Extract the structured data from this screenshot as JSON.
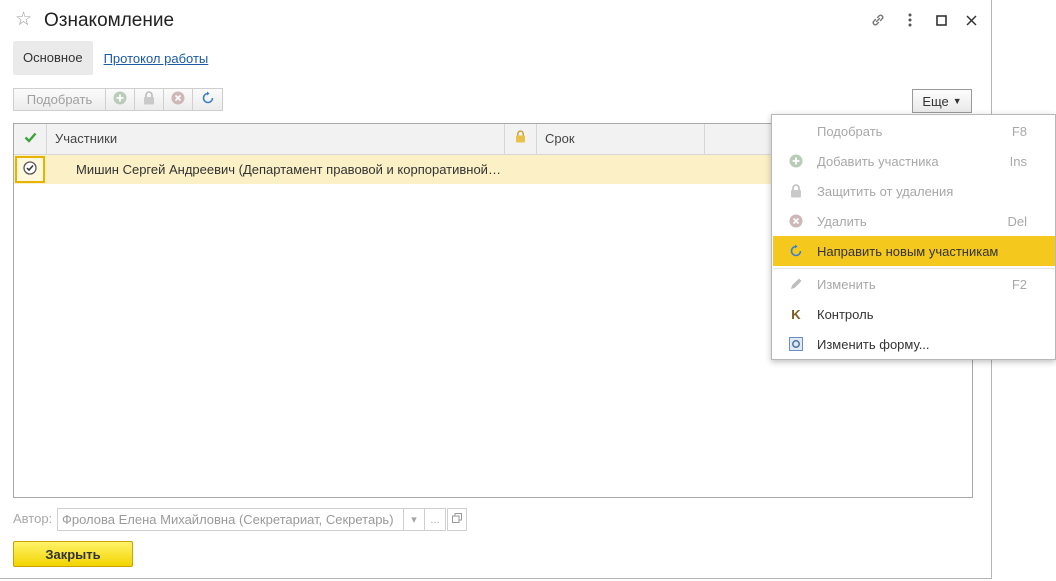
{
  "window": {
    "title": "Ознакомление",
    "favorite_icon": "star-icon",
    "controls": [
      "link-icon",
      "more-vert-icon",
      "maximize-icon",
      "close-icon"
    ]
  },
  "tabs": [
    {
      "label": "Основное",
      "active": true
    },
    {
      "label": "Протокол работы",
      "active": false
    }
  ],
  "toolbar": {
    "pick_label": "Подобрать",
    "icons": [
      "add-icon",
      "lock-icon",
      "delete-icon",
      "refresh-icon"
    ],
    "more_label": "Еще"
  },
  "table": {
    "columns": [
      "",
      "Участники",
      "",
      "Срок",
      ""
    ],
    "rows": [
      {
        "participant": "Мишин Сергей Андреевич (Департамент правовой и корпоративной…",
        "term": ""
      }
    ]
  },
  "menu": {
    "items": [
      {
        "label": "Подобрать",
        "shortcut": "F8",
        "icon": "none",
        "disabled": true
      },
      {
        "label": "Добавить участника",
        "shortcut": "Ins",
        "icon": "add-icon",
        "disabled": true
      },
      {
        "label": "Защитить от удаления",
        "shortcut": "",
        "icon": "lock-icon",
        "disabled": true
      },
      {
        "label": "Удалить",
        "shortcut": "Del",
        "icon": "delete-icon",
        "disabled": true
      },
      {
        "label": "Направить новым участникам",
        "shortcut": "",
        "icon": "refresh-icon",
        "disabled": false,
        "highlighted": true
      },
      {
        "label": "Изменить",
        "shortcut": "F2",
        "icon": "pencil-icon",
        "disabled": true
      },
      {
        "label": "Контроль",
        "shortcut": "",
        "icon": "k-icon",
        "disabled": false
      },
      {
        "label": "Изменить форму...",
        "shortcut": "",
        "icon": "form-settings-icon",
        "disabled": false
      }
    ]
  },
  "author": {
    "label": "Автор:",
    "value": "Фролова Елена Михайловна (Секретариат, Секретарь)",
    "choose_label": "..."
  },
  "footer": {
    "close_label": "Закрыть"
  },
  "colors": {
    "accent_yellow": "#f5c81e",
    "selected_row": "#fbf0c6",
    "link_blue": "#1c5aa6",
    "check_green": "#3aa53a"
  }
}
